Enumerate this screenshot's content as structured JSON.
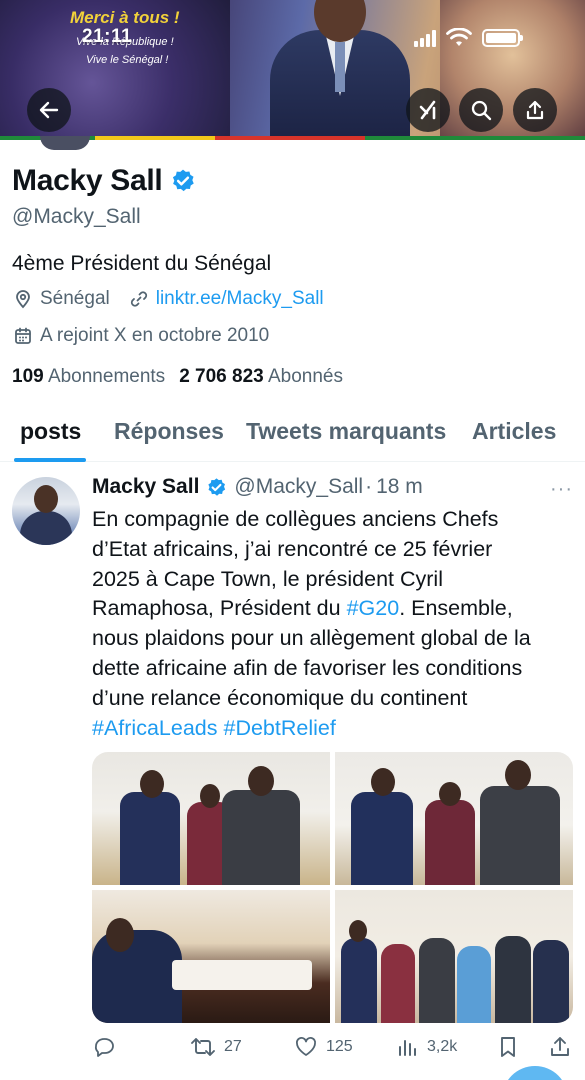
{
  "banner": {
    "line1": "Merci à tous !",
    "line2": "Vive la République !",
    "line3": "Vive le Sénégal !"
  },
  "status_bar": {
    "time": "21:11"
  },
  "header_icons": [
    "back-arrow-icon",
    "grok-icon",
    "search-icon",
    "share-icon"
  ],
  "profile": {
    "name": "Macky Sall",
    "handle": "@Macky_Sall",
    "bio": "4ème Président du Sénégal",
    "location": "Sénégal",
    "link": "linktr.ee/Macky_Sall",
    "joined": "A rejoint X en octobre 2010",
    "following_count": "109",
    "following_label": "Abonnements",
    "followers_count": "2 706 823",
    "followers_label": "Abonnés"
  },
  "tabs": [
    {
      "label": "posts",
      "active": true
    },
    {
      "label": "Réponses"
    },
    {
      "label": "Tweets marquants"
    },
    {
      "label": "Articles"
    }
  ],
  "tweet": {
    "author": "Macky Sall",
    "handle": "@Macky_Sall",
    "separator": "·",
    "time": "18 m",
    "more": "···",
    "lines": [
      "En compagnie de collègues anciens Chefs",
      "d’Etat africains, j’ai rencontré ce 25 février",
      "2025 à Cape Town, le président Cyril",
      "Ramaphosa, Président du ",
      "#G20",
      ". Ensemble,",
      "nous plaidons pour un allègement global de la",
      "dette africaine afin de favoriser les conditions",
      "d’une relance économique du continent"
    ],
    "hashtag1": "#AfricaLeads",
    "hashtag2": "#DebtRelief",
    "replies": "",
    "retweets": "27",
    "likes": "125",
    "views": "3,2k"
  },
  "colors": {
    "accent": "#1d9bf0",
    "text": "#0f1419",
    "muted": "#536471"
  }
}
